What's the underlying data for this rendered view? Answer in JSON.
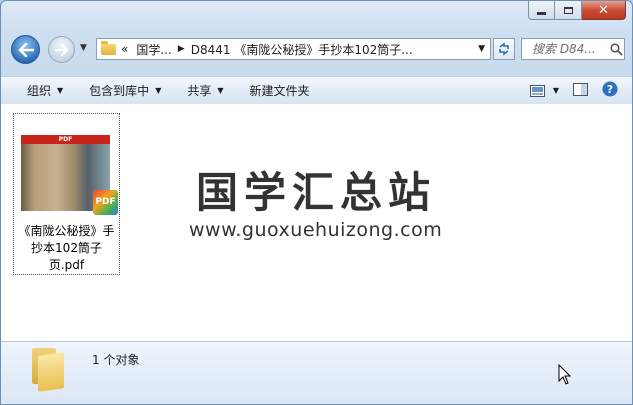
{
  "window": {
    "caption_buttons": {
      "close_symbol": "✕"
    }
  },
  "nav": {
    "breadcrumbs": [
      "«",
      "国学...",
      "D8441 《南陇公秘授》手抄本102筒子..."
    ],
    "search_placeholder": "搜索 D84..."
  },
  "toolbar": {
    "organize": "组织",
    "include_in_library": "包含到库中",
    "share": "共享",
    "new_folder": "新建文件夹"
  },
  "file": {
    "name": "《南陇公秘授》手抄本102筒子页.pdf",
    "thumb_header": "PDF",
    "badge": "PDF"
  },
  "watermark": {
    "title": "国学汇总站",
    "url": "www.guoxuehuizong.com"
  },
  "status": {
    "item_count": "1 个对象"
  },
  "colors": {
    "accent": "#2d6fb8",
    "close_red": "#c94d35",
    "folder_yellow": "#e9bf52"
  }
}
